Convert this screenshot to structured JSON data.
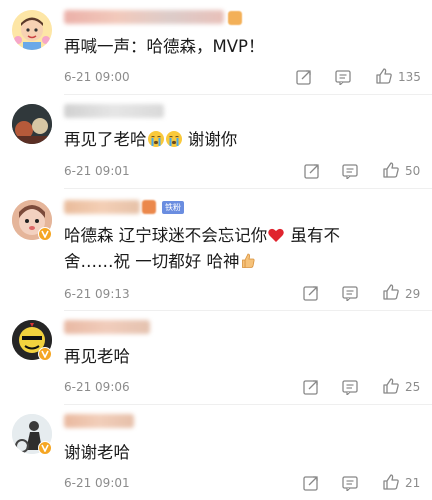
{
  "comments": [
    {
      "text": "再喊一声：哈德森，MVP！",
      "time": "6-21 09:00",
      "likes": "135"
    },
    {
      "text": "再见了老哈",
      "text_tail": " 谢谢你",
      "time": "6-21 09:01",
      "likes": "50"
    },
    {
      "text_line1": "哈德森 辽宁球迷不会忘记你",
      "text_line1_tail": " 虽有不",
      "text_line2": "舍……祝 一切都好 哈神",
      "time": "6-21 09:13",
      "likes": "29",
      "badge_label": "铁粉"
    },
    {
      "text": "再见老哈",
      "time": "6-21 09:06",
      "likes": "25"
    },
    {
      "text": "谢谢老哈",
      "time": "6-21 09:01",
      "likes": "21"
    }
  ],
  "icons": {
    "share": "share-icon",
    "comment": "comment-icon",
    "like": "like-icon",
    "heart": "red-heart-emoji",
    "cry": "crying-emoji",
    "thumb": "thumbs-up-emoji"
  },
  "colors": {
    "vip": "#f5a623",
    "fan_badge": "#6a8de0",
    "divider": "#efefef",
    "meta": "#8c8c8c"
  }
}
